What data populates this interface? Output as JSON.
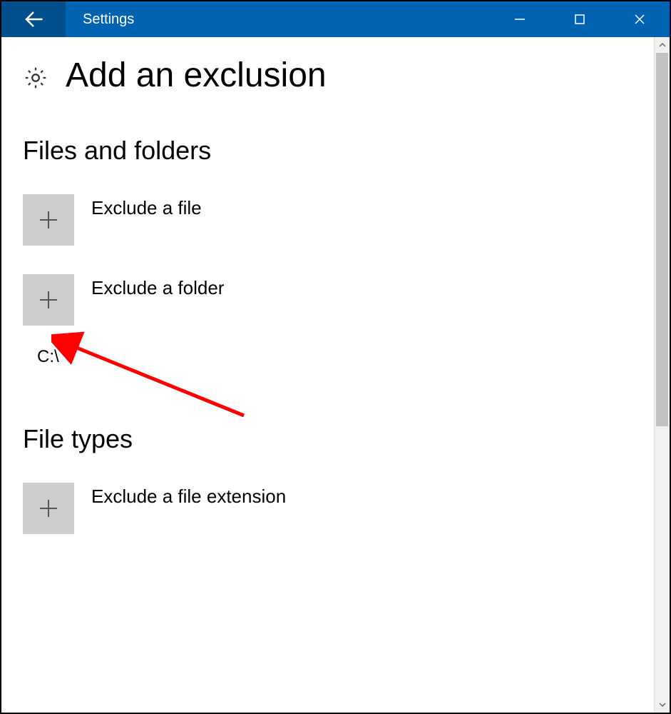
{
  "titlebar": {
    "title": "Settings"
  },
  "page": {
    "heading": "Add an exclusion"
  },
  "sections": {
    "files_folders": {
      "title": "Files and folders",
      "actions": {
        "exclude_file": "Exclude a file",
        "exclude_folder": "Exclude a folder"
      },
      "exclusions": {
        "item0": "C:\\"
      }
    },
    "file_types": {
      "title": "File types",
      "actions": {
        "exclude_extension": "Exclude a file extension"
      }
    }
  },
  "colors": {
    "titlebar_bg": "#0063b1",
    "back_bg": "#004e8c",
    "plus_bg": "#cccccc",
    "annotation": "#ff0000"
  }
}
